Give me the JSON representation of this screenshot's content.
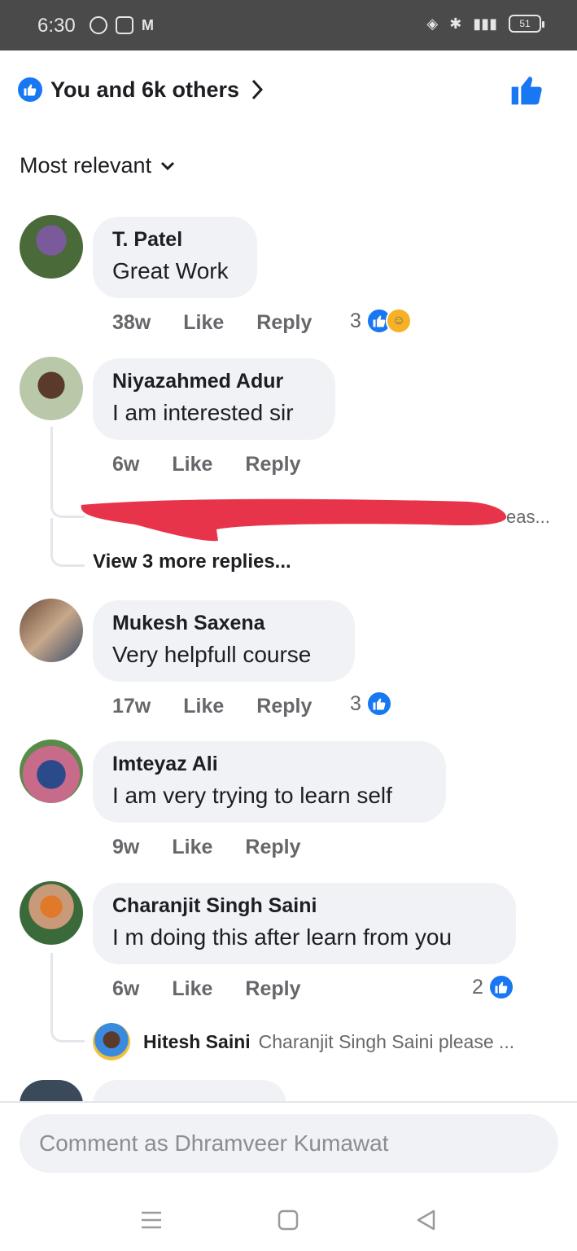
{
  "status_bar": {
    "time": "6:30",
    "battery": "51"
  },
  "reactions": {
    "summary": "You and 6k others"
  },
  "sort": {
    "label": "Most relevant"
  },
  "comments": [
    {
      "name": "T. Patel",
      "text": "Great Work",
      "time": "38w",
      "like_label": "Like",
      "reply_label": "Reply",
      "reaction_count": "3"
    },
    {
      "name": "Niyazahmed Adur",
      "text": "I am interested sir",
      "time": "6w",
      "like_label": "Like",
      "reply_label": "Reply",
      "redacted_reply_tail": "eas...",
      "view_more": "View 3 more replies..."
    },
    {
      "name": "Mukesh Saxena",
      "text": "Very helpfull course",
      "time": "17w",
      "like_label": "Like",
      "reply_label": "Reply",
      "reaction_count": "3"
    },
    {
      "name": "Imteyaz Ali",
      "text": "I am very trying to learn self",
      "time": "9w",
      "like_label": "Like",
      "reply_label": "Reply"
    },
    {
      "name": "Charanjit Singh Saini",
      "text": "I m doing this after learn from you",
      "time": "6w",
      "like_label": "Like",
      "reply_label": "Reply",
      "reaction_count": "2",
      "reply_preview": {
        "name": "Hitesh Saini",
        "text": "Charanjit Singh Saini please ..."
      }
    }
  ],
  "composer": {
    "placeholder": "Comment as Dhramveer Kumawat"
  },
  "colors": {
    "accent": "#1877f2",
    "bubble": "#f0f2f5",
    "muted": "#65676b",
    "redaction": "#e8344a"
  },
  "icons": [
    "whatsapp-icon",
    "instagram-icon",
    "gmail-icon",
    "like-icon",
    "haha-icon",
    "chevron-right-icon",
    "chevron-down-icon",
    "menu-icon",
    "home-icon",
    "back-icon"
  ]
}
